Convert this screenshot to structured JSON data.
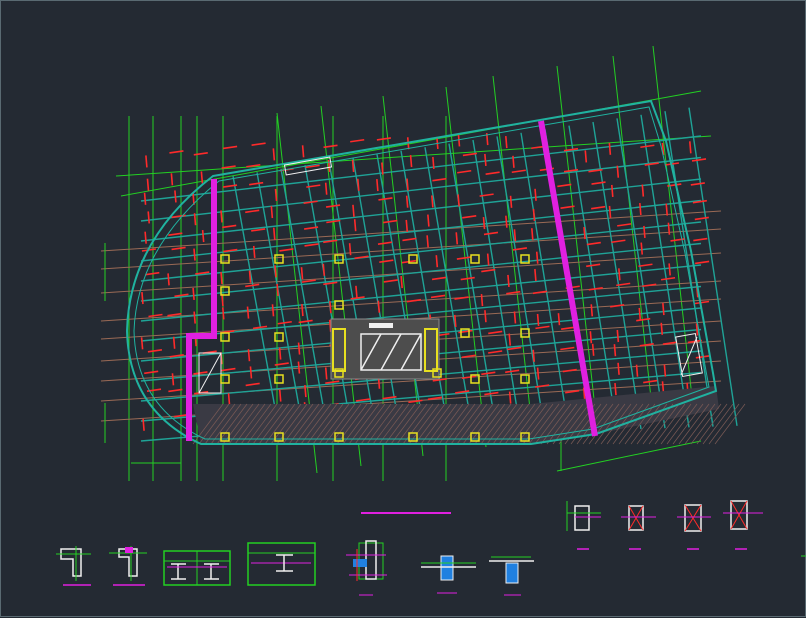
{
  "canvas": {
    "background": "#242a33"
  },
  "colors": {
    "outline": "#20b2a0",
    "grid_teal": "#1fa397",
    "dashed_red": "#ff2a2a",
    "magenta": "#e020e0",
    "axis_green": "#23d023",
    "axis_brown": "#9a6a55",
    "column_yellow": "#e8e020",
    "core_gray": "#8c8c8c",
    "white": "#f0f0f0",
    "blue": "#2080e0"
  },
  "drawing": {
    "main_plan": "structural-floor-plan",
    "details_count": 12
  }
}
